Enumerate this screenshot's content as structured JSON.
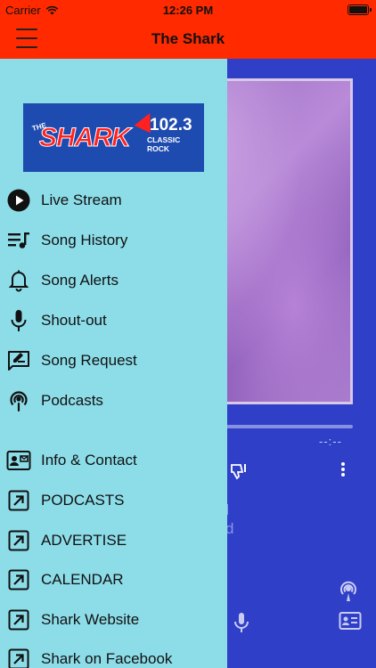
{
  "status_bar": {
    "carrier": "Carrier",
    "time": "12:26 PM",
    "battery_percent": 100
  },
  "nav": {
    "title": "The Shark",
    "menu_icon": "hamburger-menu-icon"
  },
  "logo": {
    "the": "THE",
    "brand": "SHARK",
    "frequency": "102.3",
    "format": "CLASSIC ROCK"
  },
  "menu": {
    "items": [
      {
        "label": "Live Stream",
        "icon": "play-circle-icon"
      },
      {
        "label": "Song History",
        "icon": "playlist-icon"
      },
      {
        "label": "Song Alerts",
        "icon": "bell-icon"
      },
      {
        "label": "Shout-out",
        "icon": "microphone-icon"
      },
      {
        "label": "Song Request",
        "icon": "edit-note-icon"
      },
      {
        "label": "Podcasts",
        "icon": "podcast-icon"
      }
    ],
    "links": [
      {
        "label": "Info & Contact",
        "icon": "contact-card-icon"
      },
      {
        "label": "PODCASTS",
        "icon": "external-link-icon"
      },
      {
        "label": "ADVERTISE",
        "icon": "external-link-icon"
      },
      {
        "label": "CALENDAR",
        "icon": "external-link-icon"
      },
      {
        "label": "Shark Website",
        "icon": "external-link-icon"
      },
      {
        "label": "Shark on Facebook",
        "icon": "external-link-icon"
      }
    ]
  },
  "player": {
    "duration": "--:--",
    "partial_text": "d"
  },
  "colors": {
    "nav": "#ff2a00",
    "drawer": "#8ddde9",
    "background": "#2f3fc8"
  }
}
